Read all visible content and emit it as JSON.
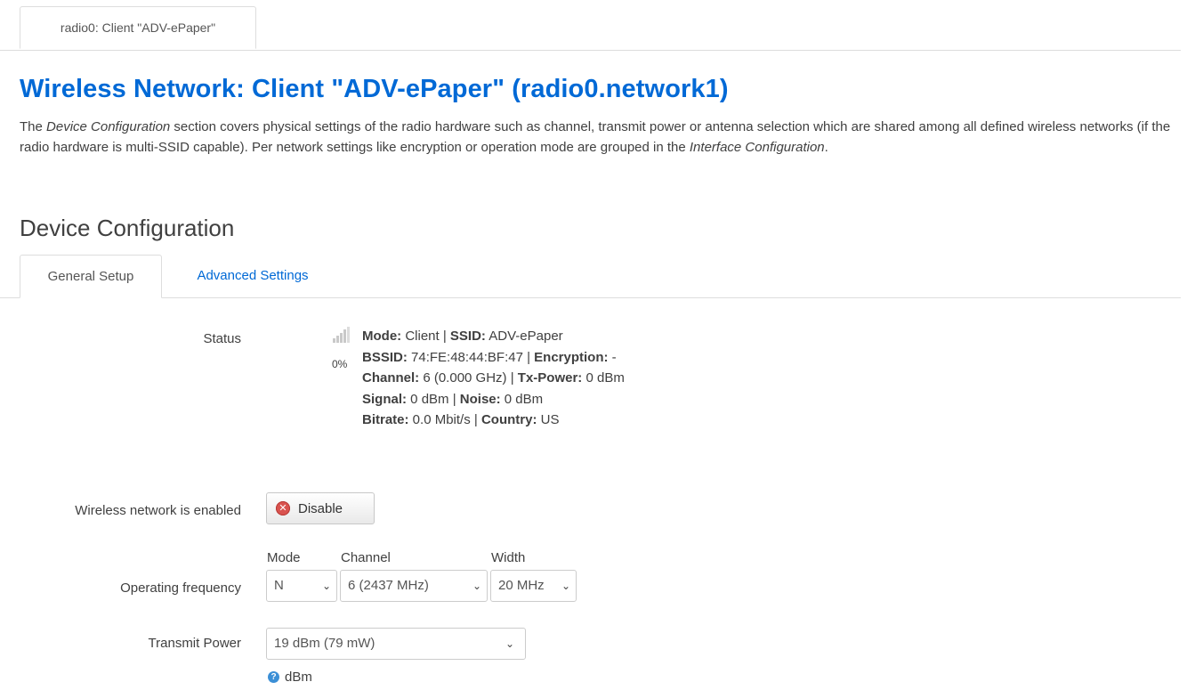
{
  "top_tab": {
    "label": "radio0: Client \"ADV-ePaper\""
  },
  "title": "Wireless Network: Client \"ADV-ePaper\" (radio0.network1)",
  "description": {
    "part1": "The ",
    "em1": "Device Configuration",
    "part2": " section covers physical settings of the radio hardware such as channel, transmit power or antenna selection which are shared among all defined wireless networks (if the radio hardware is multi-SSID capable). Per network settings like encryption or operation mode are grouped in the ",
    "em2": "Interface Configuration",
    "part3": "."
  },
  "section_title": "Device Configuration",
  "tabs": [
    {
      "label": "General Setup",
      "active": true
    },
    {
      "label": "Advanced Settings",
      "active": false
    }
  ],
  "status": {
    "label": "Status",
    "signal_percent": "0%",
    "signal_icon": "signal-bars-icon",
    "mode_key": "Mode:",
    "mode_val": " Client | ",
    "ssid_key": "SSID:",
    "ssid_val": " ADV-ePaper",
    "bssid_key": "BSSID:",
    "bssid_val": " 74:FE:48:44:BF:47 | ",
    "enc_key": "Encryption:",
    "enc_val": " -",
    "channel_key": "Channel:",
    "channel_val": " 6 (0.000 GHz) | ",
    "txp_key": "Tx-Power:",
    "txp_val": " 0 dBm",
    "signal_key": "Signal:",
    "signal_val": " 0 dBm | ",
    "noise_key": "Noise:",
    "noise_val": " 0 dBm",
    "bitrate_key": "Bitrate:",
    "bitrate_val": " 0.0 Mbit/s | ",
    "country_key": "Country:",
    "country_val": " US"
  },
  "enabled": {
    "label": "Wireless network is enabled",
    "button": "Disable",
    "button_icon": "close-circle-icon"
  },
  "frequency": {
    "label": "Operating frequency",
    "mode_label": "Mode",
    "mode_value": "N",
    "channel_label": "Channel",
    "channel_value": "6 (2437 MHz)",
    "width_label": "Width",
    "width_value": "20 MHz"
  },
  "tx_power": {
    "label": "Transmit Power",
    "value": "19 dBm (79 mW)",
    "help": "dBm",
    "help_icon": "help-icon"
  },
  "colors": {
    "accent": "#0069d6",
    "text": "#404040",
    "border": "#dddddd",
    "danger": "#d9534f"
  }
}
